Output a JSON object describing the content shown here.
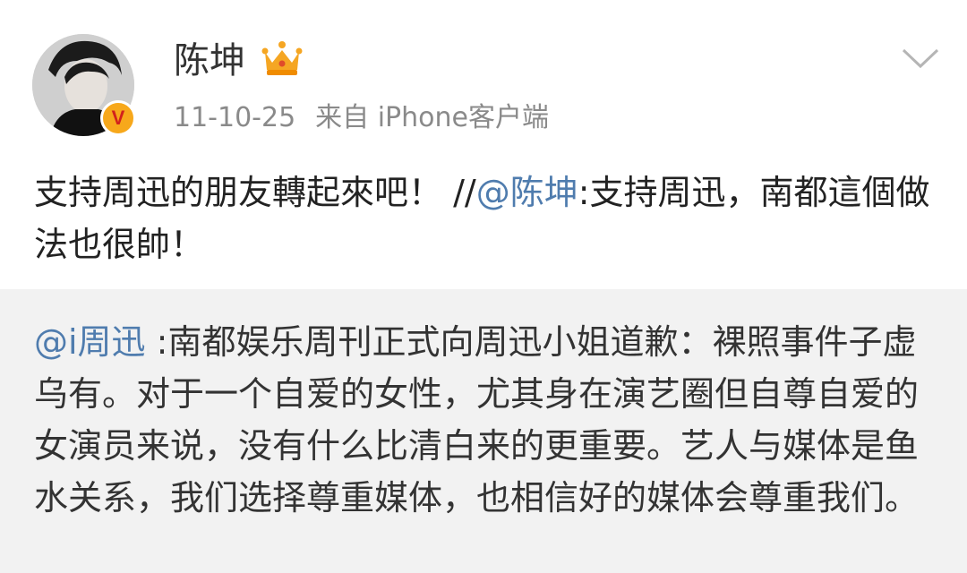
{
  "author": {
    "name": "陈坤",
    "avatar_icon": "user-avatar",
    "vip_icon": "crown-icon",
    "verified_badge": "V",
    "verified_color": "#f7a81b"
  },
  "meta": {
    "time": "11-10-25",
    "source": "来自 iPhone客户端"
  },
  "menu_icon": "chevron-down-icon",
  "post": {
    "text_main": "支持周迅的朋友轉起來吧！ //",
    "mention": "@陈坤",
    "text_rest": ":支持周迅，南都這個做法也很帥！"
  },
  "repost": {
    "mention": "@i周迅",
    "text": " :南都娱乐周刊正式向周迅小姐道歉：裸照事件子虚乌有。对于一个自爱的女性，尤其身在演艺圈但自尊自爱的女演员来说，没有什么比清白来的更重要。艺人与媒体是鱼水关系，我们选择尊重媒体，也相信好的媒体会尊重我们。"
  },
  "colors": {
    "mention": "#4f7cae",
    "repost_bg": "#f2f2f2",
    "meta_text": "#8a8a8a"
  }
}
